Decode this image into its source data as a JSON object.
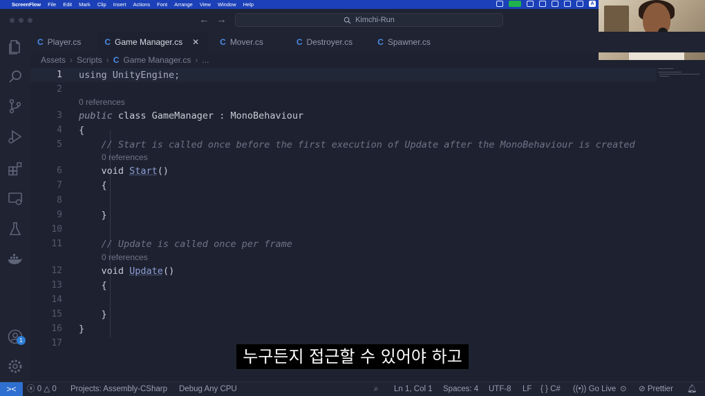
{
  "menubar": {
    "app": "ScreenFlow",
    "items": [
      "File",
      "Edit",
      "Mark",
      "Clip",
      "Insert",
      "Actions",
      "Font",
      "Arrange",
      "View",
      "Window",
      "Help"
    ],
    "input_indicator": "A"
  },
  "titlebar": {
    "search_label": "Kimchi-Run"
  },
  "tabs": [
    {
      "label": "Player.cs"
    },
    {
      "label": "Game Manager.cs",
      "active": true
    },
    {
      "label": "Mover.cs"
    },
    {
      "label": "Destroyer.cs"
    },
    {
      "label": "Spawner.cs"
    }
  ],
  "breadcrumb": {
    "parts": [
      "Assets",
      "Scripts",
      "Game Manager.cs",
      "..."
    ]
  },
  "editor": {
    "codelens": "0 references",
    "lines": [
      {
        "n": "1",
        "t": "using UnityEngine;"
      },
      {
        "n": "2",
        "t": ""
      },
      {
        "n": "3",
        "kw": "public",
        "t": " class GameManager : MonoBehaviour"
      },
      {
        "n": "4",
        "t": "{"
      },
      {
        "n": "5",
        "t": "    // Start is called once before the first execution of Update after the MonoBehaviour is created"
      },
      {
        "n": "6",
        "pre": "    void ",
        "fn": "Start",
        "post": "()"
      },
      {
        "n": "7",
        "t": "    {"
      },
      {
        "n": "8",
        "t": ""
      },
      {
        "n": "9",
        "t": "    }"
      },
      {
        "n": "10",
        "t": ""
      },
      {
        "n": "11",
        "t": "    // Update is called once per frame"
      },
      {
        "n": "12",
        "pre": "    void ",
        "fn": "Update",
        "post": "()"
      },
      {
        "n": "13",
        "t": "    {"
      },
      {
        "n": "14",
        "t": ""
      },
      {
        "n": "15",
        "t": "    }"
      },
      {
        "n": "16",
        "t": "}"
      },
      {
        "n": "17",
        "t": ""
      }
    ]
  },
  "subtitle": "누구든지 접근할 수 있어야 하고",
  "statusbar": {
    "remote_icon": "remote-icon",
    "errors": "0",
    "warnings": "0",
    "project": "Projects: Assembly-CSharp",
    "debug": "Debug Any CPU",
    "position": "Ln 1, Col 1",
    "spaces": "Spaces: 4",
    "encoding": "UTF-8",
    "eol": "LF",
    "language": "C#",
    "golive": "Go Live",
    "prettier": "Prettier"
  },
  "activity": {
    "badge": "1"
  },
  "colors": {
    "accent": "#2f6fd0",
    "menubar": "#1b40b8",
    "editor_bg": "#1e2230",
    "csharp_icon": "#4c8be8"
  }
}
